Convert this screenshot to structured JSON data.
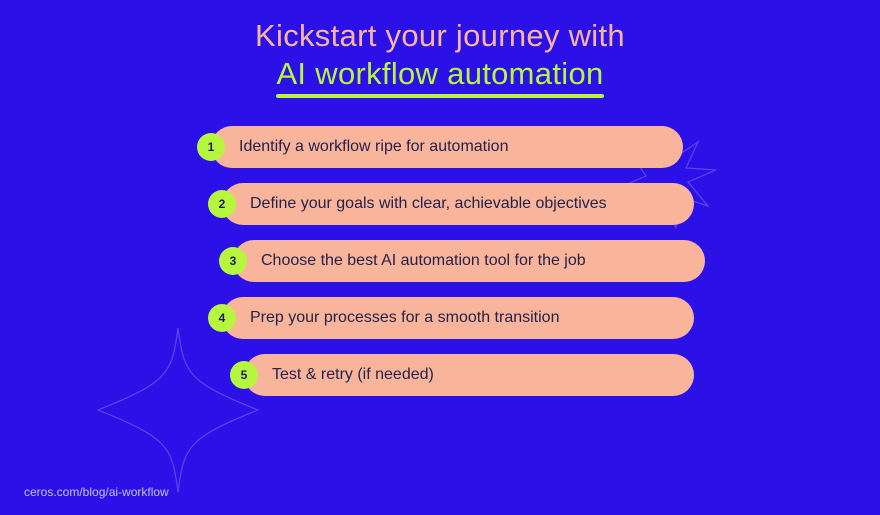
{
  "title": {
    "line1": "Kickstart your journey with",
    "line2": "AI workflow automation"
  },
  "steps": [
    {
      "num": "1",
      "label": "Identify a workflow ripe for automation"
    },
    {
      "num": "2",
      "label": "Define your goals with clear, achievable objectives"
    },
    {
      "num": "3",
      "label": "Choose the best AI automation tool for the job"
    },
    {
      "num": "4",
      "label": "Prep your processes for a smooth transition"
    },
    {
      "num": "5",
      "label": "Test & retry (if needed)"
    }
  ],
  "source_url": "ceros.com/blog/ai-workflow",
  "colors": {
    "background": "#2B10E8",
    "accent_green": "#B6F63C",
    "accent_peach": "#F9B59B",
    "text_dark": "#24214a"
  }
}
